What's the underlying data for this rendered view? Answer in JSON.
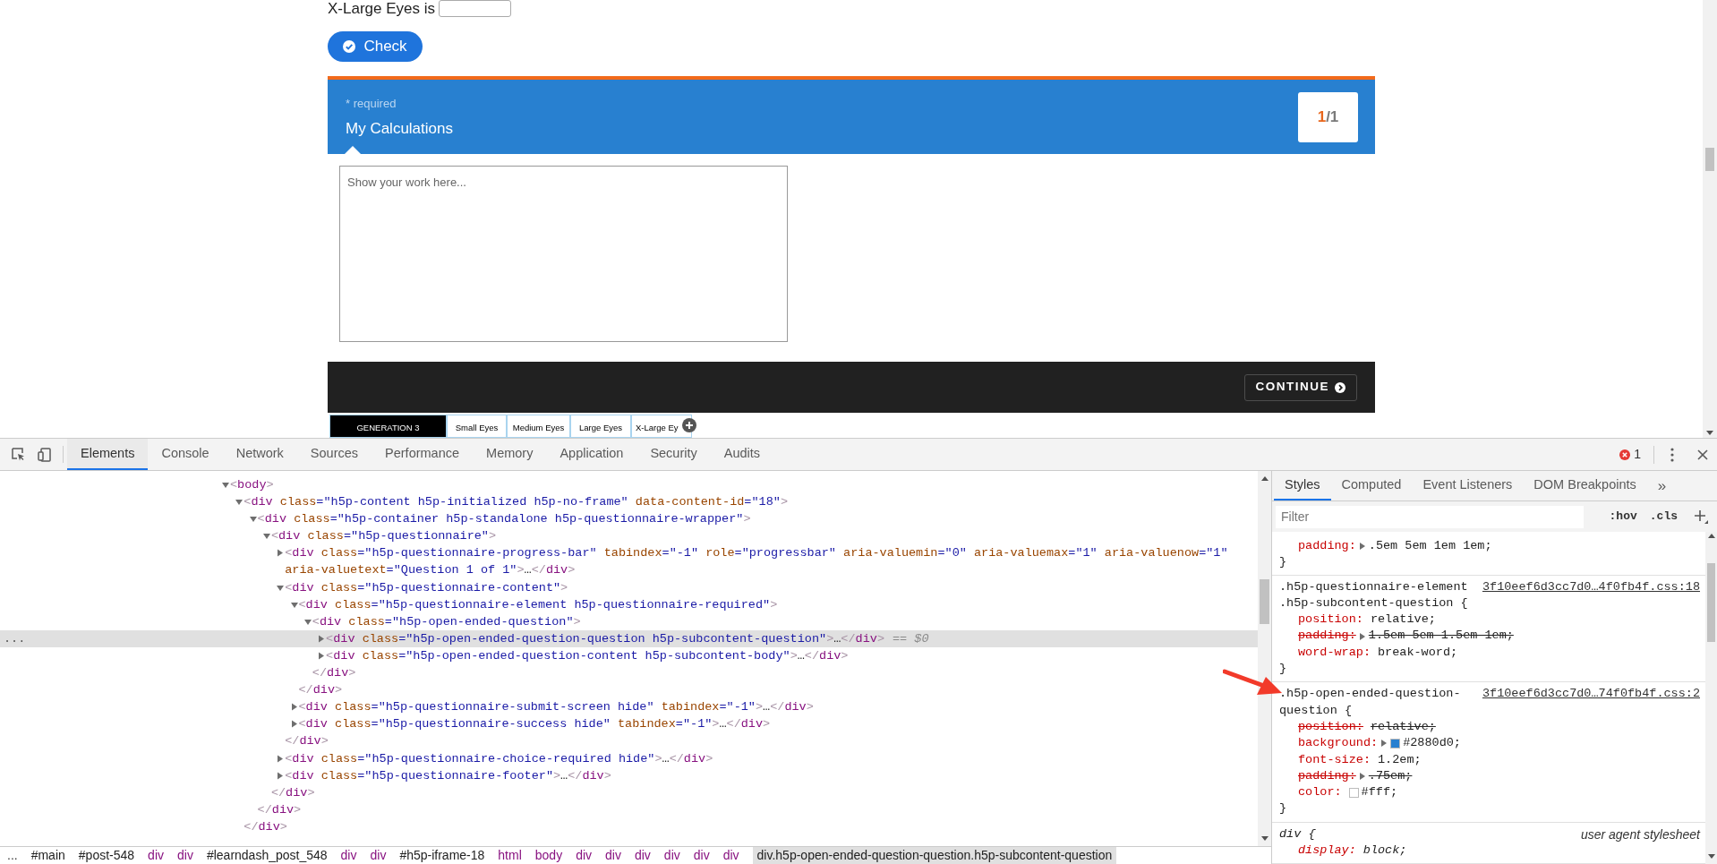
{
  "page": {
    "answer": {
      "prompt": "X-Large Eyes is"
    },
    "check_button": "Check",
    "question": {
      "required": "* required",
      "title": "My Calculations",
      "counter": {
        "current": "1",
        "separator": "/",
        "total": "1"
      }
    },
    "answer_area": {
      "placeholder": "Show your work here..."
    },
    "continue_button": "CONTINUE",
    "tabs": [
      {
        "label": "GENERATION 3",
        "selected": true
      },
      {
        "label": "Small Eyes",
        "selected": false
      },
      {
        "label": "Medium Eyes",
        "selected": false
      },
      {
        "label": "Large Eyes",
        "selected": false
      },
      {
        "label": "X-Large Ey",
        "selected": false
      }
    ]
  },
  "devtools": {
    "tabs": [
      {
        "label": "Elements",
        "selected": true
      },
      {
        "label": "Console",
        "selected": false
      },
      {
        "label": "Network",
        "selected": false
      },
      {
        "label": "Sources",
        "selected": false
      },
      {
        "label": "Performance",
        "selected": false
      },
      {
        "label": "Memory",
        "selected": false
      },
      {
        "label": "Application",
        "selected": false
      },
      {
        "label": "Security",
        "selected": false
      },
      {
        "label": "Audits",
        "selected": false
      }
    ],
    "error_count": "1",
    "dom_tree": [
      {
        "text": "<body>",
        "expanded": true,
        "selected": false,
        "children": [
          {
            "text": "<div class=\"h5p-content h5p-initialized h5p-no-frame\" data-content-id=\"18\">",
            "expanded": true,
            "selected": false,
            "closing": "</div>",
            "children": [
              {
                "text": "<div class=\"h5p-container h5p-standalone h5p-questionnaire-wrapper\">",
                "expanded": true,
                "selected": false,
                "closing": "</div>",
                "children": [
                  {
                    "text": "<div class=\"h5p-questionnaire\">",
                    "expanded": true,
                    "selected": false,
                    "closing": "</div>",
                    "children": [
                      {
                        "text": "<div class=\"h5p-questionnaire-progress-bar\" tabindex=\"-1\" role=\"progressbar\" aria-valuemin=\"0\" aria-valuemax=\"1\" aria-valuenow=\"1\" aria-valuetext=\"Question 1 of 1\">…</div>",
                        "expanded": false,
                        "selected": false
                      },
                      {
                        "text": "<div class=\"h5p-questionnaire-content\">",
                        "expanded": true,
                        "selected": false,
                        "closing": "</div>",
                        "children": [
                          {
                            "text": "<div class=\"h5p-questionnaire-element h5p-questionnaire-required\">",
                            "expanded": true,
                            "selected": false,
                            "closing": "</div>",
                            "children": [
                              {
                                "text": "<div class=\"h5p-open-ended-question\">",
                                "expanded": true,
                                "selected": false,
                                "closing": "</div>",
                                "children": [
                                  {
                                    "text": "<div class=\"h5p-open-ended-question-question h5p-subcontent-question\">…</div>",
                                    "expanded": false,
                                    "selected": true,
                                    "gutter": "...",
                                    "suffix": "== $0"
                                  },
                                  {
                                    "text": "<div class=\"h5p-open-ended-question-content h5p-subcontent-body\">…</div>",
                                    "expanded": false,
                                    "selected": false
                                  }
                                ]
                              }
                            ]
                          },
                          {
                            "text": "<div class=\"h5p-questionnaire-submit-screen hide\" tabindex=\"-1\">…</div>",
                            "expanded": false,
                            "selected": false
                          },
                          {
                            "text": "<div class=\"h5p-questionnaire-success hide\" tabindex=\"-1\">…</div>",
                            "expanded": false,
                            "selected": false
                          }
                        ]
                      },
                      {
                        "text": "<div class=\"h5p-questionnaire-choice-required hide\">…</div>",
                        "expanded": false,
                        "selected": false
                      },
                      {
                        "text": "<div class=\"h5p-questionnaire-footer\">…</div>",
                        "expanded": false,
                        "selected": false
                      }
                    ]
                  }
                ]
              }
            ]
          }
        ]
      }
    ],
    "breadcrumb": [
      {
        "label": "...",
        "kind": "more",
        "selected": false
      },
      {
        "label": "#main",
        "kind": "id",
        "selected": false
      },
      {
        "label": "#post-548",
        "kind": "id",
        "selected": false
      },
      {
        "label": "div",
        "kind": "tag",
        "selected": false
      },
      {
        "label": "div",
        "kind": "tag",
        "selected": false
      },
      {
        "label": "#learndash_post_548",
        "kind": "id",
        "selected": false
      },
      {
        "label": "div",
        "kind": "tag",
        "selected": false
      },
      {
        "label": "div",
        "kind": "tag",
        "selected": false
      },
      {
        "label": "#h5p-iframe-18",
        "kind": "id",
        "selected": false
      },
      {
        "label": "html",
        "kind": "tag",
        "selected": false
      },
      {
        "label": "body",
        "kind": "tag",
        "selected": false
      },
      {
        "label": "div",
        "kind": "tag",
        "selected": false
      },
      {
        "label": "div",
        "kind": "tag",
        "selected": false
      },
      {
        "label": "div",
        "kind": "tag",
        "selected": false
      },
      {
        "label": "div",
        "kind": "tag",
        "selected": false
      },
      {
        "label": "div",
        "kind": "tag",
        "selected": false
      },
      {
        "label": "div",
        "kind": "tag",
        "selected": false
      },
      {
        "label": "div.h5p-open-ended-question-question.h5p-subcontent-question",
        "kind": "id",
        "selected": true
      }
    ],
    "styles_pane": {
      "tabs": [
        {
          "label": "Styles",
          "selected": true
        },
        {
          "label": "Computed",
          "selected": false
        },
        {
          "label": "Event Listeners",
          "selected": false
        },
        {
          "label": "DOM Breakpoints",
          "selected": false
        }
      ],
      "overflow": "»",
      "filter": {
        "placeholder": "Filter"
      },
      "hov": ":hov",
      "cls": ".cls",
      "rules": [
        {
          "user_agent": false,
          "closing": "}",
          "declarations": [
            {
              "property": "padding:",
              "value": ".5em 5em 1em 1em;",
              "expandable": true,
              "overridden": false
            }
          ]
        },
        {
          "selector": ".h5p-questionnaire-element .h5p-subcontent-question {",
          "source": "3f10eef6d3cc7d0…4f0fb4f.css:18",
          "user_agent": false,
          "closing": "}",
          "declarations": [
            {
              "property": "position:",
              "value": "relative;",
              "expandable": false,
              "overridden": false
            },
            {
              "property": "padding:",
              "value": "1.5em 5em 1.5em 1em;",
              "expandable": true,
              "overridden": true
            },
            {
              "property": "word-wrap:",
              "value": "break-word;",
              "expandable": false,
              "overridden": false
            }
          ]
        },
        {
          "selector": ".h5p-open-ended-question-question {",
          "source": "3f10eef6d3cc7d0…74f0fb4f.css:2",
          "user_agent": false,
          "closing": "}",
          "declarations": [
            {
              "property": "position:",
              "value": "relative;",
              "expandable": false,
              "overridden": true
            },
            {
              "property": "background:",
              "value": "#2880d0;",
              "expandable": true,
              "overridden": false,
              "color": "#2880d0"
            },
            {
              "property": "font-size:",
              "value": "1.2em;",
              "expandable": false,
              "overridden": false
            },
            {
              "property": "padding:",
              "value": ".75em;",
              "expandable": true,
              "overridden": true
            },
            {
              "property": "color:",
              "value": "#fff;",
              "expandable": false,
              "overridden": false,
              "color": "#ffffff"
            }
          ]
        },
        {
          "selector": "div {",
          "source": "user agent stylesheet",
          "user_agent": true,
          "declarations": [
            {
              "property": "display:",
              "value": "block;",
              "expandable": false,
              "overridden": false
            }
          ]
        }
      ]
    }
  }
}
